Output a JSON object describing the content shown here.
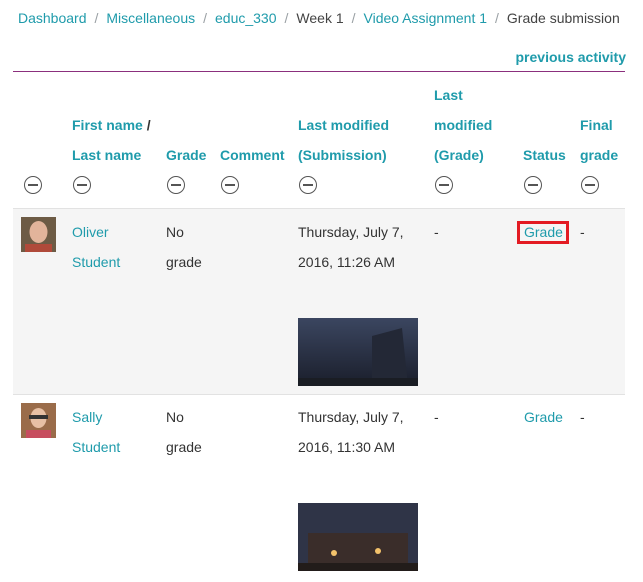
{
  "breadcrumb": [
    "Dashboard",
    "Miscellaneous",
    "educ_330",
    "Week 1",
    "Video Assignment 1",
    "Grade submission"
  ],
  "previous_activity": "previous activity",
  "table": {
    "headers": {
      "first_name": "First name",
      "slash": " /",
      "last_name": "Last name",
      "grade": "Grade",
      "comment": "Comment",
      "last_modified_sub_1": "Last modified",
      "last_modified_sub_2": "(Submission)",
      "last_modified_grade_1": "Last",
      "last_modified_grade_2": "modified",
      "last_modified_grade_3": "(Grade)",
      "status": "Status",
      "final_grade_1": "Final",
      "final_grade_2": "grade"
    },
    "rows": [
      {
        "first": "Oliver",
        "last": "Student",
        "grade_1": "No",
        "grade_2": "grade",
        "modified_1": "Thursday, July 7,",
        "modified_2": "2016, 11:26 AM",
        "modified_grade": "-",
        "status": "Grade",
        "final": "-"
      },
      {
        "first": "Sally",
        "last": "Student",
        "grade_1": "No",
        "grade_2": "grade",
        "modified_1": "Thursday, July 7,",
        "modified_2": "2016, 11:30 AM",
        "modified_grade": "-",
        "status": "Grade",
        "final": "-"
      }
    ]
  },
  "colors": {
    "accent": "#1f9bab",
    "rule": "#8b2f7d",
    "highlight": "#e31b23"
  }
}
